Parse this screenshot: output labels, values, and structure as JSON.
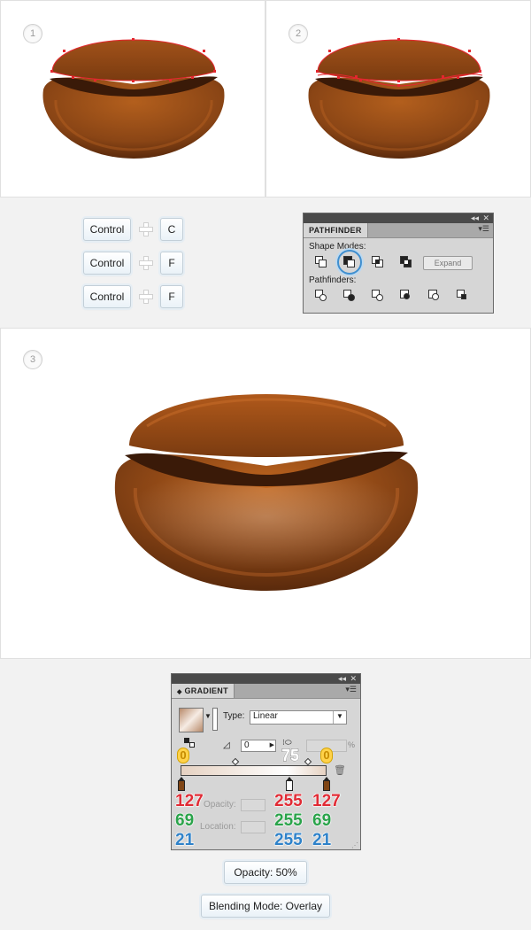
{
  "steps": [
    "1",
    "2",
    "3"
  ],
  "shortcuts": [
    {
      "modifier": "Control",
      "key": "C"
    },
    {
      "modifier": "Control",
      "key": "F"
    },
    {
      "modifier": "Control",
      "key": "F"
    }
  ],
  "pathfinder": {
    "title": "PATHFINDER",
    "shape_modes_label": "Shape Modes:",
    "pathfinders_label": "Pathfinders:",
    "expand_label": "Expand",
    "collapse_icon": "double-chevron-left",
    "close_icon": "close-x",
    "menu_icon": "panel-menu",
    "highlight_color": "#3f8fd0"
  },
  "gradient": {
    "title": "GRADIENT",
    "type_label": "Type:",
    "type_value": "Linear",
    "angle_value": "0",
    "aspect_value": "75",
    "pct_symbol": "%",
    "opacity_label": "Opacity:",
    "location_label": "Location:",
    "badge_left": "0",
    "badge_right": "0",
    "stops": [
      {
        "r": "127",
        "g": "69",
        "b": "21"
      },
      {
        "r": "255",
        "g": "255",
        "b": "255"
      },
      {
        "r": "127",
        "g": "69",
        "b": "21"
      }
    ],
    "opacity_caption": "Opacity: 50%",
    "blending_caption": "Blending Mode: Overlay"
  },
  "colors": {
    "bean_dark": "#5a2a0c",
    "bean_mid": "#8a4515",
    "bean_light": "#b35f1d",
    "seam": "#3a1a08",
    "path_red": "#e4262e"
  }
}
